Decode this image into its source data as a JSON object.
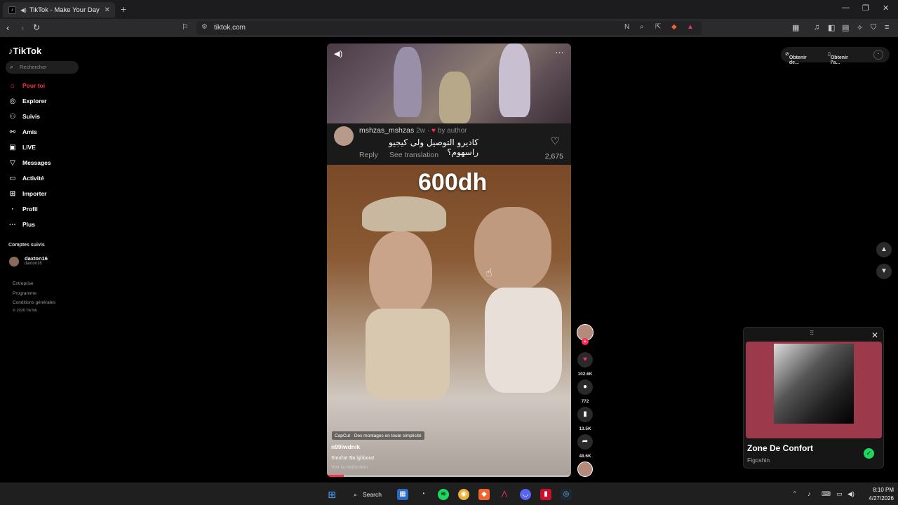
{
  "browser": {
    "tab_title": "TikTok - Make Your Day",
    "tab_close": "✕",
    "new_tab": "+",
    "url": "tiktok.com"
  },
  "sidebar": {
    "logo": "TikTok",
    "search_placeholder": "Rechercher",
    "items": [
      {
        "label": "Pour toi",
        "icon": "home-icon",
        "glyph": "⌂",
        "active": true
      },
      {
        "label": "Explorer",
        "icon": "compass-icon",
        "glyph": "◎",
        "active": false
      },
      {
        "label": "Suivis",
        "icon": "user-follow-icon",
        "glyph": "⚇",
        "active": false
      },
      {
        "label": "Amis",
        "icon": "friends-icon",
        "glyph": "⚯",
        "active": false
      },
      {
        "label": "LIVE",
        "icon": "live-icon",
        "glyph": "▣",
        "active": false
      },
      {
        "label": "Messages",
        "icon": "send-icon",
        "glyph": "▽",
        "active": false
      },
      {
        "label": "Activité",
        "icon": "activity-icon",
        "glyph": "▭",
        "active": false
      },
      {
        "label": "Importer",
        "icon": "upload-icon",
        "glyph": "⊞",
        "active": false
      },
      {
        "label": "Profil",
        "icon": "profile-icon",
        "glyph": "·",
        "active": false
      },
      {
        "label": "Plus",
        "icon": "more-icon",
        "glyph": "···",
        "active": false
      }
    ],
    "following_title": "Comptes suivis",
    "following": [
      {
        "name": "daxton16",
        "handle": "daxton16"
      }
    ],
    "footer": [
      "Entreprise",
      "Programme",
      "Conditions générales",
      "© 2026 TikTok"
    ]
  },
  "video": {
    "comment": {
      "user": "mshzas_mshzas",
      "age": "2w",
      "by_author": "by author",
      "text": "كاديرو التوصيل ولى كيجيو راسهوم؟",
      "reply": "Reply",
      "see_translation": "See translation",
      "likes": "2,675"
    },
    "overlay_text": "600dh",
    "capcut": "CapCut · Des montages en toute simplicité",
    "author": "n99iwdnik",
    "description": "Smol'at 3la lghbora!",
    "translate": "Voir la traduction",
    "progress": 0.07
  },
  "actions": {
    "likes": "102.6K",
    "comments": "772",
    "saves": "13.5K",
    "shares": "48.6K"
  },
  "right_top": {
    "get_app": "Obtenir de...",
    "get_app2": "Obtenir l'a..."
  },
  "miniplayer": {
    "title": "Zone De Confort",
    "artist": "Figoshin"
  },
  "taskbar": {
    "search": "Search",
    "time": "8:10 PM",
    "date": "4/27/2026"
  }
}
